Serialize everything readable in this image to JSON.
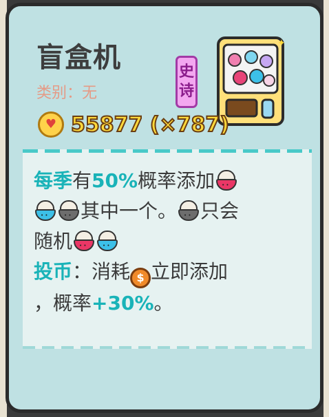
{
  "item": {
    "name": "盲盒机",
    "category": "类别：无",
    "rarity": [
      "史",
      "诗"
    ],
    "price": "55877 (×787)"
  },
  "description": {
    "line1_kw": "每季",
    "line1_a": "有",
    "line1_pct": "50%",
    "line1_b": "概率添加",
    "line2_a": "其中一个。",
    "line2_b": "只会",
    "line3_a": "随机",
    "line4_kw": "投币",
    "line4_a": "：消耗",
    "line4_b": "立即添加",
    "line5_a": "，概率",
    "line5_pct": "+30%",
    "line5_b": "。"
  },
  "icons": {
    "coin": "gold-heart-coin-icon",
    "bowl": "bowl-icon",
    "dollar": "dollar-coin-icon",
    "machine": "gacha-machine-icon"
  },
  "colors": {
    "card_bg": "#bfe1e3",
    "keyword": "#19b3b8",
    "price": "#ffd93a",
    "rarity": "#a23aa6"
  }
}
